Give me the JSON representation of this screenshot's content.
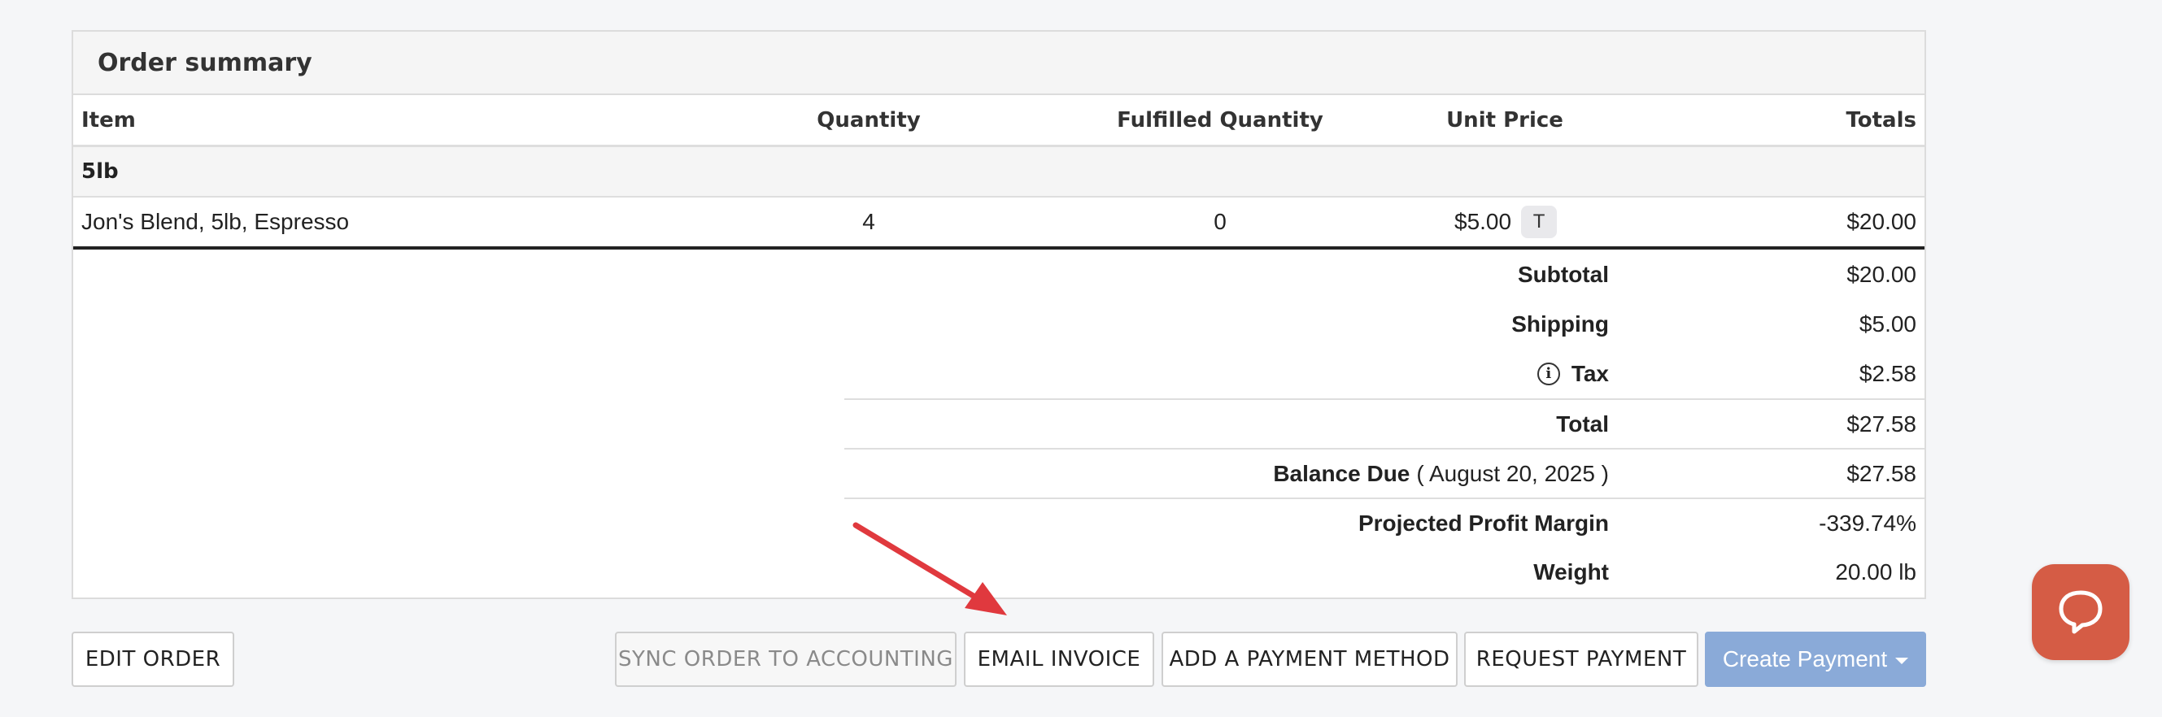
{
  "panel": {
    "title": "Order summary"
  },
  "table": {
    "headers": {
      "item": "Item",
      "quantity": "Quantity",
      "fulfilled": "Fulfilled Quantity",
      "unit_price": "Unit Price",
      "totals": "Totals"
    },
    "group": "5lb",
    "rows": [
      {
        "item": "Jon's Blend, 5lb, Espresso",
        "quantity": "4",
        "fulfilled": "0",
        "unit_price": "$5.00",
        "tax_badge": "T",
        "total": "$20.00"
      }
    ]
  },
  "summary": {
    "subtotal": {
      "label": "Subtotal",
      "value": "$20.00"
    },
    "shipping": {
      "label": "Shipping",
      "value": "$5.00"
    },
    "tax": {
      "label": "Tax",
      "value": "$2.58",
      "icon": "info-icon"
    },
    "total": {
      "label": "Total",
      "value": "$27.58"
    },
    "balance_due": {
      "label": "Balance Due",
      "date": "( August 20, 2025 )",
      "value": "$27.58"
    },
    "profit_margin": {
      "label": "Projected Profit Margin",
      "value": "-339.74%"
    },
    "weight": {
      "label": "Weight",
      "value": "20.00 lb"
    }
  },
  "buttons": {
    "edit_order": "EDIT ORDER",
    "sync_accounting": "SYNC ORDER TO ACCOUNTING",
    "email_invoice": "EMAIL INVOICE",
    "add_payment_method": "ADD A PAYMENT METHOD",
    "request_payment": "REQUEST PAYMENT",
    "create_payment": "Create Payment"
  },
  "colors": {
    "primary_button": "#8aaad8",
    "chat_button": "#d55c45",
    "arrow": "#e0393e"
  }
}
